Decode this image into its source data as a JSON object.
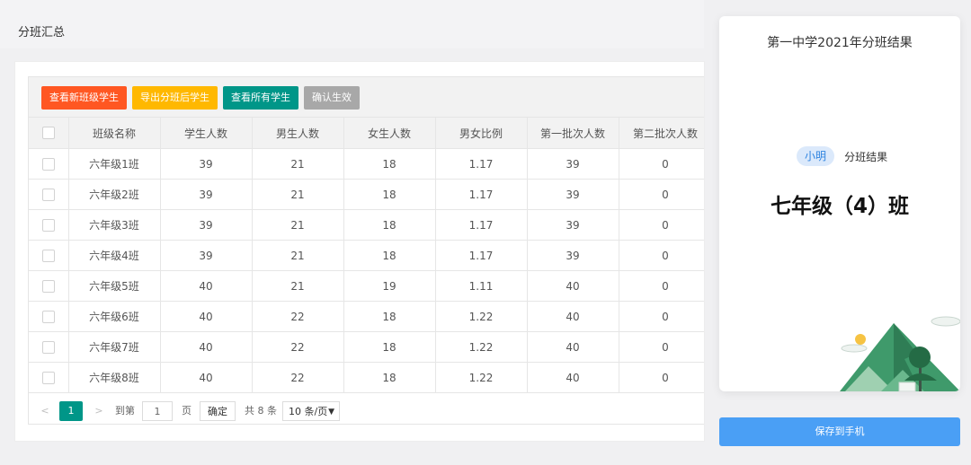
{
  "page_title": "分班汇总",
  "toolbar": {
    "btn_new_students": "查看新班级学生",
    "btn_export": "导出分班后学生",
    "btn_all_students": "查看所有学生",
    "btn_confirm": "确认生效"
  },
  "table": {
    "headers": [
      "班级名称",
      "学生人数",
      "男生人数",
      "女生人数",
      "男女比例",
      "第一批次人数",
      "第二批次人数"
    ],
    "rows": [
      [
        "六年级1班",
        "39",
        "21",
        "18",
        "1.17",
        "39",
        "0"
      ],
      [
        "六年级2班",
        "39",
        "21",
        "18",
        "1.17",
        "39",
        "0"
      ],
      [
        "六年级3班",
        "39",
        "21",
        "18",
        "1.17",
        "39",
        "0"
      ],
      [
        "六年级4班",
        "39",
        "21",
        "18",
        "1.17",
        "39",
        "0"
      ],
      [
        "六年级5班",
        "40",
        "21",
        "19",
        "1.11",
        "40",
        "0"
      ],
      [
        "六年级6班",
        "40",
        "22",
        "18",
        "1.22",
        "40",
        "0"
      ],
      [
        "六年级7班",
        "40",
        "22",
        "18",
        "1.22",
        "40",
        "0"
      ],
      [
        "六年级8班",
        "40",
        "22",
        "18",
        "1.22",
        "40",
        "0"
      ]
    ]
  },
  "pager": {
    "prev": "<",
    "current": "1",
    "next": ">",
    "goto_label": "到第",
    "goto_value": "1",
    "page_label": "页",
    "confirm": "确定",
    "total": "共 8 条",
    "page_size": "10 条/页"
  },
  "result_card": {
    "title": "第一中学2021年分班结果",
    "student_name": "小明",
    "label": "分班结果",
    "class_name": "七年级（4）班"
  },
  "save_button": "保存到手机",
  "colors": {
    "red": "#ff5722",
    "yellow": "#ffb800",
    "teal": "#009688",
    "gray": "#a8a8a8",
    "blue": "#4a9ff5"
  }
}
